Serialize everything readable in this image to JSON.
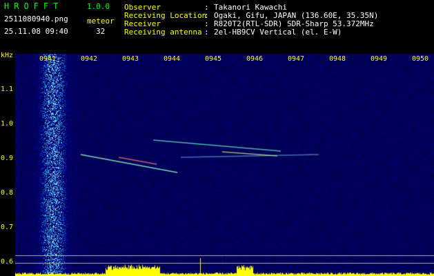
{
  "logo": "HROFFT",
  "version": "1.0.0",
  "filename": "2511080940.png",
  "datetime": "25.11.08 09:40",
  "meteor": {
    "label": "meteor",
    "count": "32"
  },
  "info": [
    {
      "label": "Observer",
      "sep": ":",
      "value": "Takanori Kawachi"
    },
    {
      "label": "Receiving Location",
      "sep": ":",
      "value": "Ogaki, Gifu, JAPAN (136.60E, 35.35N)"
    },
    {
      "label": "Receiver",
      "sep": ":",
      "value": "R820T2(RTL-SDR) SDR-Sharp 53.372MHz"
    },
    {
      "label": "Receiving antenna",
      "sep": ":",
      "value": "2el-HB9CV Vertical (el. E-W)"
    }
  ],
  "axis": {
    "unit": "kHz",
    "x_ticks": [
      "0941",
      "0942",
      "0943",
      "0944",
      "0945",
      "0946",
      "0947",
      "0948",
      "0949",
      "0950"
    ],
    "y_ticks": [
      "1.1",
      "1.0",
      "0.9",
      "0.8",
      "0.7",
      "0.6"
    ]
  },
  "colors": {
    "header_text": "#ffffff",
    "accent": "#ffff00",
    "logo": "#00ff00",
    "background": "#00003a"
  }
}
